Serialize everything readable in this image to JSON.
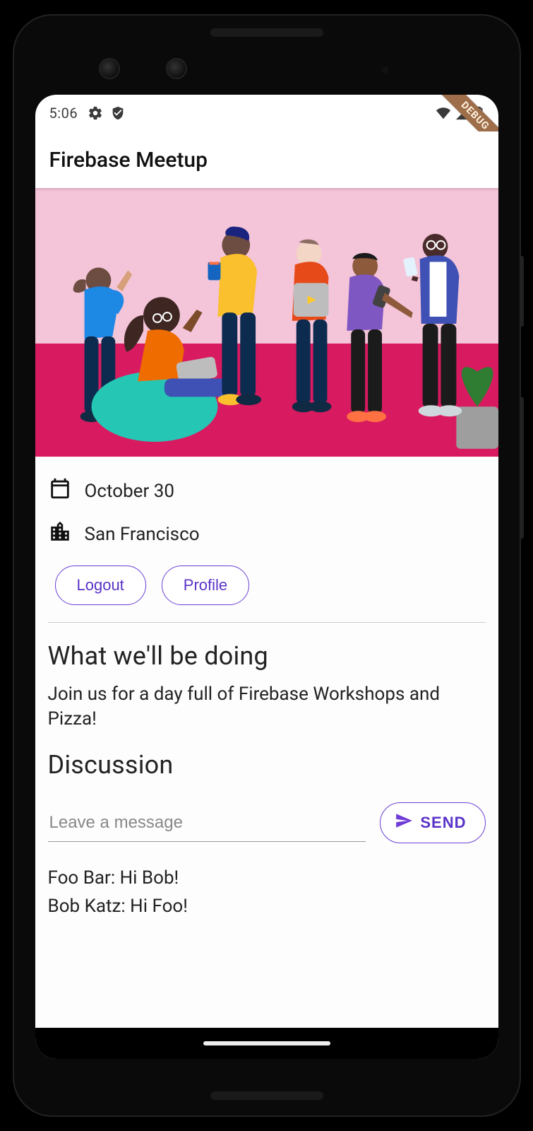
{
  "statusbar": {
    "time": "5:06"
  },
  "debug_banner": "DEBUG",
  "appbar": {
    "title": "Firebase Meetup"
  },
  "event": {
    "date": "October 30",
    "location": "San Francisco"
  },
  "buttons": {
    "logout": "Logout",
    "profile": "Profile",
    "send": "SEND"
  },
  "sections": {
    "what_heading": "What we'll be doing",
    "what_body": "Join us for a day full of Firebase Workshops and Pizza!",
    "discussion_heading": "Discussion"
  },
  "message_input": {
    "placeholder": "Leave a message",
    "value": ""
  },
  "messages": [
    {
      "author": "Foo Bar",
      "text": "Hi Bob!"
    },
    {
      "author": "Bob Katz",
      "text": "Hi Foo!"
    }
  ],
  "accent_color": "#5a33c7"
}
